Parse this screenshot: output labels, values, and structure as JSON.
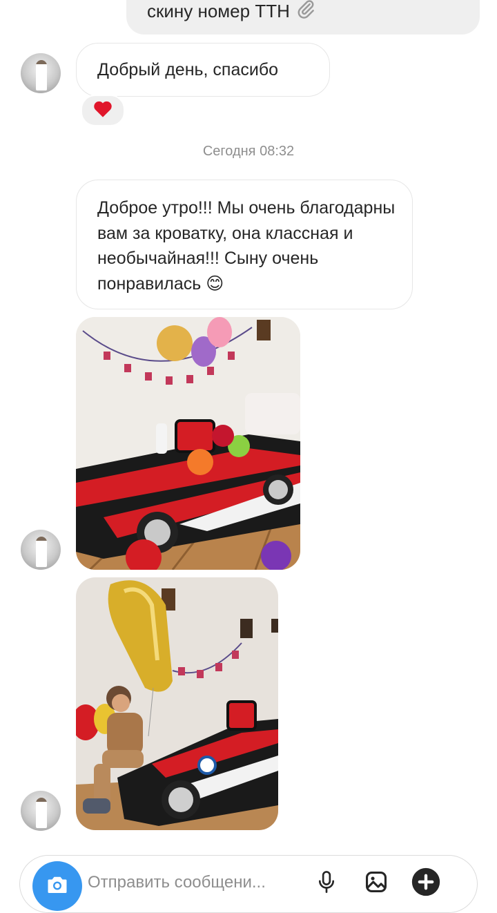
{
  "thread": {
    "outgoing_partial": {
      "text": "скину номер ТТН",
      "icon": "paperclip-icon"
    },
    "messages": [
      {
        "text": "Добрый день, спасибо",
        "reaction": "heart"
      },
      {
        "text": "Доброе утро!!! Мы очень благодарны вам за кроватку, она классная и необычайная!!! Сыну очень понравилась 😊"
      }
    ],
    "date_separator": "Сегодня 08:32",
    "photos": [
      {
        "description": "race car bed in room with balloons"
      },
      {
        "description": "boy with balloon next to race car bed"
      }
    ]
  },
  "composer": {
    "placeholder": "Отправить сообщени...",
    "icons": [
      "camera-icon",
      "microphone-icon",
      "gallery-icon",
      "plus-icon"
    ]
  },
  "colors": {
    "accent": "#3797f0",
    "bubble_out": "#efefef",
    "bed_red": "#d41d24",
    "bed_black": "#1a1a1a"
  }
}
